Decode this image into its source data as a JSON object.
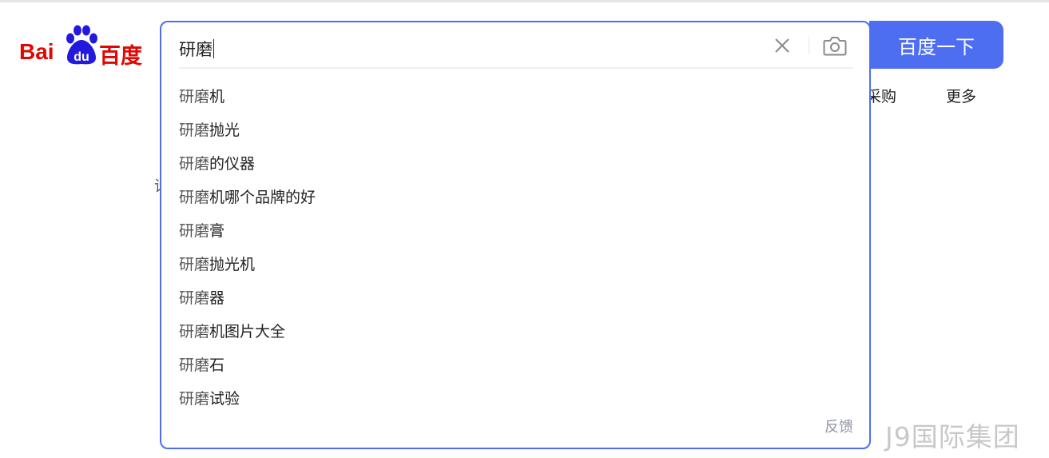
{
  "logo": {
    "text_latin": "Bai",
    "text_paw": "du",
    "text_cn": "百度"
  },
  "search": {
    "query": "研磨",
    "clear_icon": "close-icon",
    "camera_icon": "camera-icon",
    "button_label": "百度一下",
    "suggestions": [
      {
        "prefix": "研磨",
        "rest": "机"
      },
      {
        "prefix": "研磨",
        "rest": "抛光"
      },
      {
        "prefix": "研磨",
        "rest": "的仪器"
      },
      {
        "prefix": "研磨",
        "rest": "机哪个品牌的好"
      },
      {
        "prefix": "研磨",
        "rest": "膏"
      },
      {
        "prefix": "研磨",
        "rest": "抛光机"
      },
      {
        "prefix": "研磨",
        "rest": "器"
      },
      {
        "prefix": "研磨",
        "rest": "机图片大全"
      },
      {
        "prefix": "研磨",
        "rest": "石"
      },
      {
        "prefix": "研磨",
        "rest": "试验"
      }
    ],
    "feedback_label": "反馈"
  },
  "nav": {
    "procure_label": "采购",
    "more_label": "更多"
  },
  "background": {
    "stray_char": "请"
  },
  "watermark": "J9国际集团",
  "colors": {
    "accent": "#4e6ef2",
    "logo_red": "#e10602",
    "logo_blue": "#2319dc"
  }
}
